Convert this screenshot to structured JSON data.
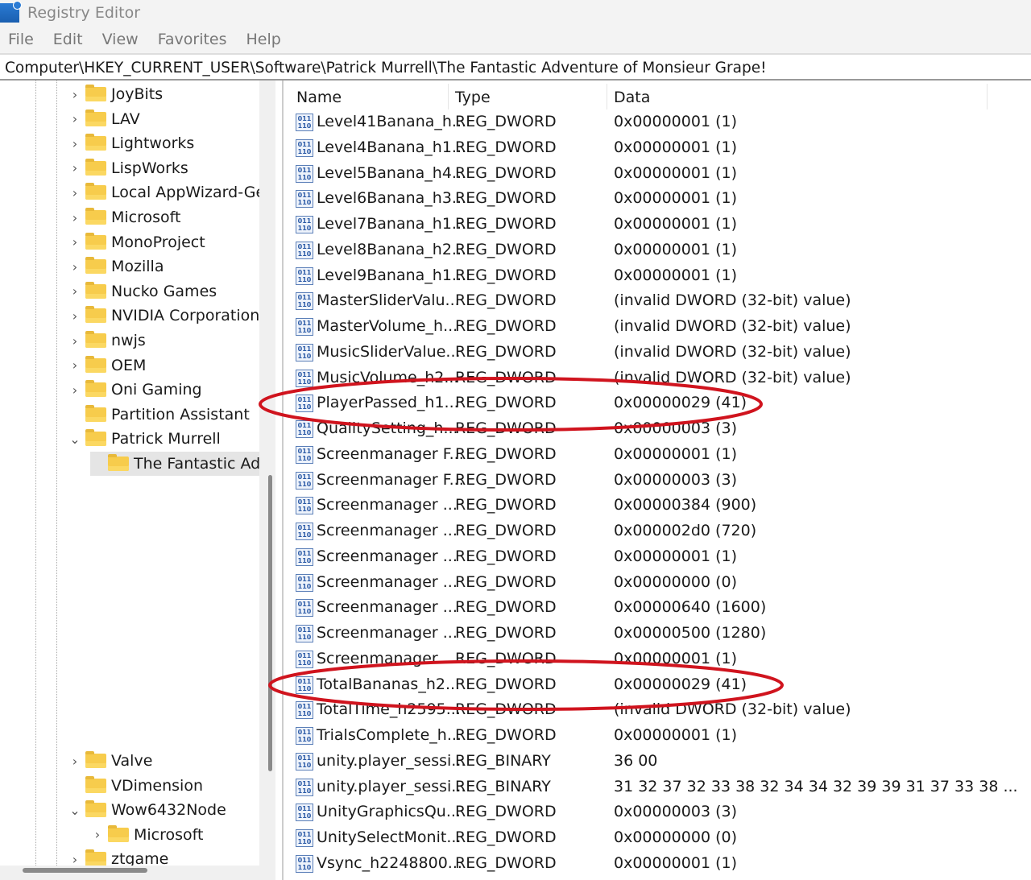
{
  "window": {
    "title": "Registry Editor"
  },
  "menu": [
    "File",
    "Edit",
    "View",
    "Favorites",
    "Help"
  ],
  "address": "Computer\\HKEY_CURRENT_USER\\Software\\Patrick Murrell\\The Fantastic Adventure of Monsieur Grape!",
  "tree": [
    {
      "label": "JoyBits",
      "chev": ">",
      "indent": 0
    },
    {
      "label": "LAV",
      "chev": ">",
      "indent": 0
    },
    {
      "label": "Lightworks",
      "chev": ">",
      "indent": 0
    },
    {
      "label": "LispWorks",
      "chev": ">",
      "indent": 0
    },
    {
      "label": "Local AppWizard-Generated Applications",
      "chev": ">",
      "indent": 0
    },
    {
      "label": "Microsoft",
      "chev": ">",
      "indent": 0
    },
    {
      "label": "MonoProject",
      "chev": ">",
      "indent": 0
    },
    {
      "label": "Mozilla",
      "chev": ">",
      "indent": 0
    },
    {
      "label": "Nucko Games",
      "chev": ">",
      "indent": 0
    },
    {
      "label": "NVIDIA Corporation",
      "chev": ">",
      "indent": 0
    },
    {
      "label": "nwjs",
      "chev": ">",
      "indent": 0
    },
    {
      "label": "OEM",
      "chev": ">",
      "indent": 0
    },
    {
      "label": "Oni Gaming",
      "chev": ">",
      "indent": 0
    },
    {
      "label": "Partition Assistant",
      "chev": "",
      "indent": 0
    },
    {
      "label": "Patrick Murrell",
      "chev": "v",
      "indent": 0
    },
    {
      "label": "The Fantastic Adventure of Monsieur Grape!",
      "chev": "",
      "indent": 1,
      "selected": true
    }
  ],
  "tree_bottom": [
    {
      "label": "Valve",
      "chev": ">",
      "indent": 0
    },
    {
      "label": "VDimension",
      "chev": "",
      "indent": 0
    },
    {
      "label": "Wow6432Node",
      "chev": "v",
      "indent": 0
    },
    {
      "label": "Microsoft",
      "chev": ">",
      "indent": 1
    },
    {
      "label": "ztgame",
      "chev": ">",
      "indent": 0
    }
  ],
  "columns": [
    "Name",
    "Type",
    "Data"
  ],
  "rows": [
    [
      "Level41Banana_h...",
      "REG_DWORD",
      "0x00000001 (1)"
    ],
    [
      "Level4Banana_h1...",
      "REG_DWORD",
      "0x00000001 (1)"
    ],
    [
      "Level5Banana_h4...",
      "REG_DWORD",
      "0x00000001 (1)"
    ],
    [
      "Level6Banana_h3...",
      "REG_DWORD",
      "0x00000001 (1)"
    ],
    [
      "Level7Banana_h1...",
      "REG_DWORD",
      "0x00000001 (1)"
    ],
    [
      "Level8Banana_h2...",
      "REG_DWORD",
      "0x00000001 (1)"
    ],
    [
      "Level9Banana_h1...",
      "REG_DWORD",
      "0x00000001 (1)"
    ],
    [
      "MasterSliderValu...",
      "REG_DWORD",
      "(invalid DWORD (32-bit) value)"
    ],
    [
      "MasterVolume_h...",
      "REG_DWORD",
      "(invalid DWORD (32-bit) value)"
    ],
    [
      "MusicSliderValue...",
      "REG_DWORD",
      "(invalid DWORD (32-bit) value)"
    ],
    [
      "MusicVolume_h2...",
      "REG_DWORD",
      "(invalid DWORD (32-bit) value)"
    ],
    [
      "PlayerPassed_h1...",
      "REG_DWORD",
      "0x00000029 (41)"
    ],
    [
      "QualitySetting_h...",
      "REG_DWORD",
      "0x00000003 (3)"
    ],
    [
      "Screenmanager F...",
      "REG_DWORD",
      "0x00000001 (1)"
    ],
    [
      "Screenmanager F...",
      "REG_DWORD",
      "0x00000003 (3)"
    ],
    [
      "Screenmanager ...",
      "REG_DWORD",
      "0x00000384 (900)"
    ],
    [
      "Screenmanager ...",
      "REG_DWORD",
      "0x000002d0 (720)"
    ],
    [
      "Screenmanager ...",
      "REG_DWORD",
      "0x00000001 (1)"
    ],
    [
      "Screenmanager ...",
      "REG_DWORD",
      "0x00000000 (0)"
    ],
    [
      "Screenmanager ...",
      "REG_DWORD",
      "0x00000640 (1600)"
    ],
    [
      "Screenmanager ...",
      "REG_DWORD",
      "0x00000500 (1280)"
    ],
    [
      "Screenmanager ...",
      "REG_DWORD",
      "0x00000001 (1)"
    ],
    [
      "TotalBananas_h2...",
      "REG_DWORD",
      "0x00000029 (41)"
    ],
    [
      "TotalTime_h2595...",
      "REG_DWORD",
      "(invalid DWORD (32-bit) value)"
    ],
    [
      "TrialsComplete_h...",
      "REG_DWORD",
      "0x00000001 (1)"
    ],
    [
      "unity.player_sessi...",
      "REG_BINARY",
      "36 00"
    ],
    [
      "unity.player_sessi...",
      "REG_BINARY",
      "31 32 37 32 33 38 32 34 34 32 39 39 31 37 33 38 ..."
    ],
    [
      "UnityGraphicsQu...",
      "REG_DWORD",
      "0x00000003 (3)"
    ],
    [
      "UnitySelectMonit...",
      "REG_DWORD",
      "0x00000000 (0)"
    ],
    [
      "Vsync_h2248800...",
      "REG_DWORD",
      "0x00000001 (1)"
    ]
  ],
  "highlighted_rows": [
    11,
    22
  ],
  "colors": {
    "annotation": "#d0141e",
    "folder": "#f7cc4c"
  }
}
